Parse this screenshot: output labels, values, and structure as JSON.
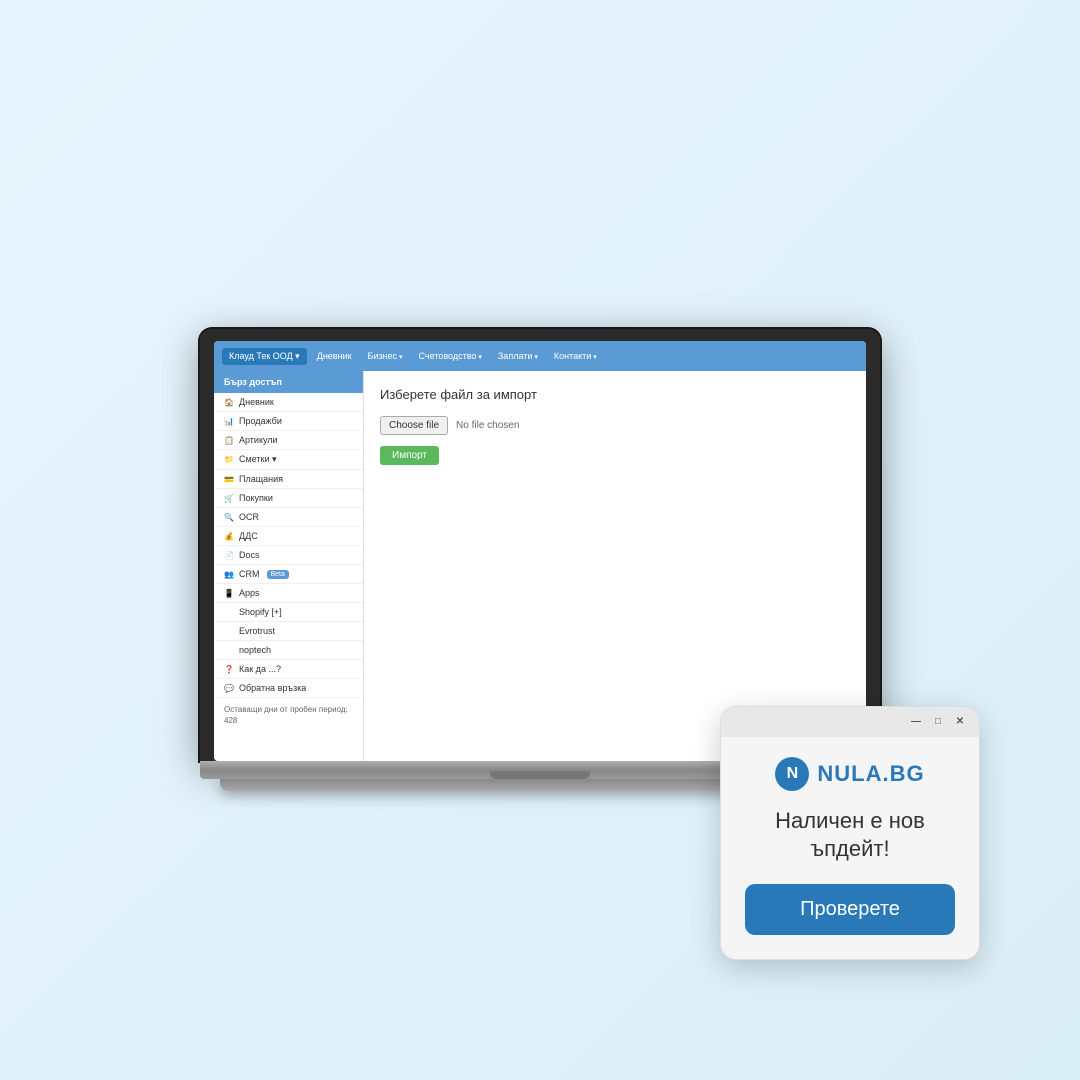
{
  "background_color": "#daeef8",
  "nav": {
    "brand": "Клауд Тек ООД ▾",
    "items": [
      {
        "label": "Дневник",
        "has_arrow": false
      },
      {
        "label": "Бизнес",
        "has_arrow": true
      },
      {
        "label": "Счетоводство",
        "has_arrow": true
      },
      {
        "label": "Заплати",
        "has_arrow": true
      },
      {
        "label": "Контакти",
        "has_arrow": true
      }
    ]
  },
  "sidebar": {
    "header": "Бърз достъп",
    "items": [
      {
        "icon": "🏠",
        "label": "Дневник"
      },
      {
        "icon": "📊",
        "label": "Продажби"
      },
      {
        "icon": "📋",
        "label": "Артикули"
      },
      {
        "icon": "📁",
        "label": "Сметки ▾"
      },
      {
        "icon": "💳",
        "label": "Плащания"
      },
      {
        "icon": "🛒",
        "label": "Покупки"
      },
      {
        "icon": "🔍",
        "label": "OCR"
      },
      {
        "icon": "💰",
        "label": "ДДС"
      },
      {
        "icon": "📄",
        "label": "Docs"
      },
      {
        "icon": "👥",
        "label": "CRM",
        "badge": "Beta"
      },
      {
        "icon": "📱",
        "label": "Apps"
      },
      {
        "icon": "",
        "label": "Shopify [+]"
      },
      {
        "icon": "",
        "label": "Evrotrust"
      },
      {
        "icon": "",
        "label": "noptech"
      },
      {
        "icon": "❓",
        "label": "Как да ...?"
      },
      {
        "icon": "💬",
        "label": "Обратна връзка"
      }
    ],
    "trial_label": "Оставащи дни от пробен период: 428"
  },
  "content": {
    "title": "Изберете файл за импорт",
    "choose_file_label": "Choose file",
    "no_file_text": "No file chosen",
    "import_button": "Импорт"
  },
  "popup": {
    "titlebar_buttons": [
      "—",
      "□",
      "✕"
    ],
    "logo_icon": "N",
    "logo_text": "NULA.BG",
    "message": "Наличен е нов ъпдейт!",
    "cta_label": "Проверете"
  }
}
